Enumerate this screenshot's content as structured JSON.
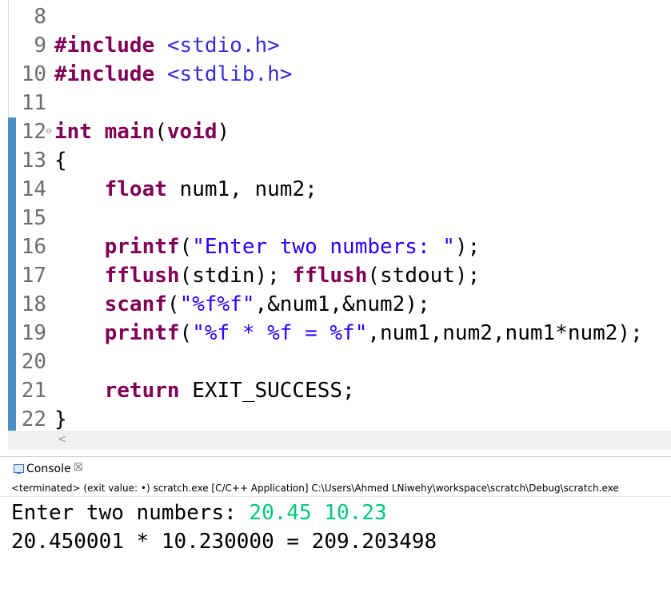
{
  "editor": {
    "lines": [
      {
        "num": "8",
        "segments": []
      },
      {
        "num": "9",
        "segments": [
          {
            "cls": "kw",
            "text": "#include"
          },
          {
            "cls": "",
            "text": " "
          },
          {
            "cls": "inc",
            "text": "<stdio.h>"
          }
        ]
      },
      {
        "num": "10",
        "segments": [
          {
            "cls": "kw",
            "text": "#include"
          },
          {
            "cls": "",
            "text": " "
          },
          {
            "cls": "inc",
            "text": "<stdlib.h>"
          }
        ]
      },
      {
        "num": "11",
        "segments": []
      },
      {
        "num": "12",
        "fold": "⊖",
        "segments": [
          {
            "cls": "kw",
            "text": "int"
          },
          {
            "cls": "",
            "text": " "
          },
          {
            "cls": "kw",
            "text": "main"
          },
          {
            "cls": "",
            "text": "("
          },
          {
            "cls": "kw",
            "text": "void"
          },
          {
            "cls": "",
            "text": ")"
          }
        ]
      },
      {
        "num": "13",
        "segments": [
          {
            "cls": "",
            "text": "{"
          }
        ]
      },
      {
        "num": "14",
        "segments": [
          {
            "cls": "",
            "text": "    "
          },
          {
            "cls": "kw",
            "text": "float"
          },
          {
            "cls": "",
            "text": " num1, num2;"
          }
        ]
      },
      {
        "num": "15",
        "segments": []
      },
      {
        "num": "16",
        "segments": [
          {
            "cls": "",
            "text": "    "
          },
          {
            "cls": "kw",
            "text": "printf"
          },
          {
            "cls": "",
            "text": "("
          },
          {
            "cls": "str",
            "text": "\"Enter two numbers: \""
          },
          {
            "cls": "",
            "text": ");"
          }
        ]
      },
      {
        "num": "17",
        "segments": [
          {
            "cls": "",
            "text": "    "
          },
          {
            "cls": "kw",
            "text": "fflush"
          },
          {
            "cls": "",
            "text": "(stdin); "
          },
          {
            "cls": "kw",
            "text": "fflush"
          },
          {
            "cls": "",
            "text": "(stdout);"
          }
        ]
      },
      {
        "num": "18",
        "segments": [
          {
            "cls": "",
            "text": "    "
          },
          {
            "cls": "kw",
            "text": "scanf"
          },
          {
            "cls": "",
            "text": "("
          },
          {
            "cls": "str",
            "text": "\"%f%f\""
          },
          {
            "cls": "",
            "text": ",&num1,&num2);"
          }
        ]
      },
      {
        "num": "19",
        "segments": [
          {
            "cls": "",
            "text": "    "
          },
          {
            "cls": "kw",
            "text": "printf"
          },
          {
            "cls": "",
            "text": "("
          },
          {
            "cls": "str",
            "text": "\"%f * %f = %f\""
          },
          {
            "cls": "",
            "text": ",num1,num2,num1*num2);"
          }
        ]
      },
      {
        "num": "20",
        "segments": []
      },
      {
        "num": "21",
        "segments": [
          {
            "cls": "",
            "text": "    "
          },
          {
            "cls": "kw",
            "text": "return"
          },
          {
            "cls": "",
            "text": " EXIT_SUCCESS;"
          }
        ]
      },
      {
        "num": "22",
        "segments": [
          {
            "cls": "",
            "text": "}"
          }
        ]
      }
    ],
    "hscroll_left": "<"
  },
  "console": {
    "tab_label": "Console",
    "close_glyph": "☒",
    "status": "<terminated> (exit value: •) scratch.exe [C/C++ Application] C:\\Users\\Ahmed LNiwehy\\workspace\\scratch\\Debug\\scratch.exe",
    "output_line1_prefix": "Enter two numbers: ",
    "output_line1_input": "20.45 10.23",
    "output_line2": "20.450001 * 10.230000 = 209.203498"
  },
  "colors": {
    "keyword": "#7f0055",
    "string": "#2a00ff",
    "user_input": "#00c87d",
    "ruler": "#4e8ec7"
  }
}
